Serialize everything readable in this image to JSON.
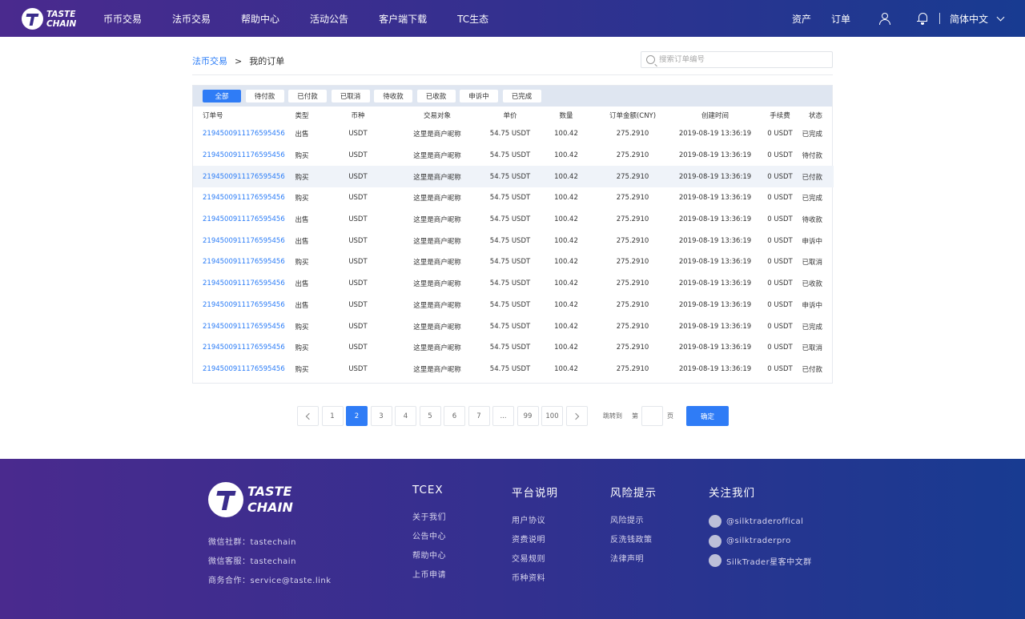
{
  "header": {
    "logo": {
      "line1": "TASTE",
      "line2": "CHAIN"
    },
    "nav": [
      "币币交易",
      "法币交易",
      "帮助中心",
      "活动公告",
      "客户端下载",
      "TC生态"
    ],
    "assets": "资产",
    "orders": "订单",
    "language": "简体中文"
  },
  "breadcrumb": {
    "parent": "法币交易",
    "separator": ">",
    "current": "我的订单"
  },
  "search": {
    "placeholder": "搜索订单编号"
  },
  "filters": [
    "全部",
    "待付款",
    "已付款",
    "已取消",
    "待收款",
    "已收款",
    "申诉中",
    "已完成"
  ],
  "table": {
    "headers": [
      "订单号",
      "类型",
      "币种",
      "交易对象",
      "单价",
      "数量",
      "订单金额(CNY)",
      "创建时间",
      "手续费",
      "状态"
    ],
    "rows": [
      {
        "id": "2194500911176595456",
        "type": "出售",
        "kind": "sell",
        "coin": "USDT",
        "party": "这里是商户昵称",
        "price": "54.75 USDT",
        "qty": "100.42",
        "amount": "275.2910",
        "time": "2019-08-19 13:36:19",
        "fee": "0 USDT",
        "status": "已完成",
        "status_style": "gray"
      },
      {
        "id": "2194500911176595456",
        "type": "购买",
        "kind": "buy",
        "coin": "USDT",
        "party": "这里是商户昵称",
        "price": "54.75 USDT",
        "qty": "100.42",
        "amount": "275.2910",
        "time": "2019-08-19 13:36:19",
        "fee": "0 USDT",
        "status": "待付款",
        "status_style": "blue"
      },
      {
        "id": "2194500911176595456",
        "type": "购买",
        "kind": "buy",
        "coin": "USDT",
        "party": "这里是商户昵称",
        "price": "54.75 USDT",
        "qty": "100.42",
        "amount": "275.2910",
        "time": "2019-08-19 13:36:19",
        "fee": "0 USDT",
        "status": "已付款",
        "status_style": "blue"
      },
      {
        "id": "2194500911176595456",
        "type": "购买",
        "kind": "buy",
        "coin": "USDT",
        "party": "这里是商户昵称",
        "price": "54.75 USDT",
        "qty": "100.42",
        "amount": "275.2910",
        "time": "2019-08-19 13:36:19",
        "fee": "0 USDT",
        "status": "已完成",
        "status_style": "gray"
      },
      {
        "id": "2194500911176595456",
        "type": "出售",
        "kind": "sell",
        "coin": "USDT",
        "party": "这里是商户昵称",
        "price": "54.75 USDT",
        "qty": "100.42",
        "amount": "275.2910",
        "time": "2019-08-19 13:36:19",
        "fee": "0 USDT",
        "status": "待收款",
        "status_style": "blue"
      },
      {
        "id": "2194500911176595456",
        "type": "出售",
        "kind": "sell",
        "coin": "USDT",
        "party": "这里是商户昵称",
        "price": "54.75 USDT",
        "qty": "100.42",
        "amount": "275.2910",
        "time": "2019-08-19 13:36:19",
        "fee": "0 USDT",
        "status": "申诉中",
        "status_style": "blue"
      },
      {
        "id": "2194500911176595456",
        "type": "购买",
        "kind": "buy",
        "coin": "USDT",
        "party": "这里是商户昵称",
        "price": "54.75 USDT",
        "qty": "100.42",
        "amount": "275.2910",
        "time": "2019-08-19 13:36:19",
        "fee": "0 USDT",
        "status": "已取消",
        "status_style": "gray"
      },
      {
        "id": "2194500911176595456",
        "type": "出售",
        "kind": "sell",
        "coin": "USDT",
        "party": "这里是商户昵称",
        "price": "54.75 USDT",
        "qty": "100.42",
        "amount": "275.2910",
        "time": "2019-08-19 13:36:19",
        "fee": "0 USDT",
        "status": "已收款",
        "status_style": "blue"
      },
      {
        "id": "2194500911176595456",
        "type": "出售",
        "kind": "sell",
        "coin": "USDT",
        "party": "这里是商户昵称",
        "price": "54.75 USDT",
        "qty": "100.42",
        "amount": "275.2910",
        "time": "2019-08-19 13:36:19",
        "fee": "0 USDT",
        "status": "申诉中",
        "status_style": "blue"
      },
      {
        "id": "2194500911176595456",
        "type": "购买",
        "kind": "buy",
        "coin": "USDT",
        "party": "这里是商户昵称",
        "price": "54.75 USDT",
        "qty": "100.42",
        "amount": "275.2910",
        "time": "2019-08-19 13:36:19",
        "fee": "0 USDT",
        "status": "已完成",
        "status_style": "gray"
      },
      {
        "id": "2194500911176595456",
        "type": "购买",
        "kind": "buy",
        "coin": "USDT",
        "party": "这里是商户昵称",
        "price": "54.75 USDT",
        "qty": "100.42",
        "amount": "275.2910",
        "time": "2019-08-19 13:36:19",
        "fee": "0 USDT",
        "status": "已取消",
        "status_style": "gray"
      },
      {
        "id": "2194500911176595456",
        "type": "购买",
        "kind": "buy",
        "coin": "USDT",
        "party": "这里是商户昵称",
        "price": "54.75 USDT",
        "qty": "100.42",
        "amount": "275.2910",
        "time": "2019-08-19 13:36:19",
        "fee": "0 USDT",
        "status": "已付款",
        "status_style": "blue"
      }
    ]
  },
  "pagination": {
    "pages": [
      "1",
      "2",
      "3",
      "4",
      "5",
      "6",
      "7",
      "...",
      "99",
      "100"
    ],
    "current": "2",
    "jump_label": "跳转到",
    "jump_di": "第",
    "jump_ye": "页",
    "confirm": "确定"
  },
  "footer": {
    "logo": {
      "line1": "TASTE",
      "line2": "CHAIN"
    },
    "info": [
      "微信社群：tastechain",
      "微信客服：tastechain",
      "商务合作：service@taste.link"
    ],
    "columns": [
      {
        "title": "TCEX",
        "links": [
          "关于我们",
          "公告中心",
          "帮助中心",
          "上币申请"
        ]
      },
      {
        "title": "平台说明",
        "links": [
          "用户协议",
          "资费说明",
          "交易规则",
          "币种资料"
        ]
      },
      {
        "title": "风险提示",
        "links": [
          "风险提示",
          "反洗钱政策",
          "法律声明"
        ]
      }
    ],
    "follow": {
      "title": "关注我们",
      "items": [
        "@silktraderoffical",
        "@silktraderpro",
        "SilkTrader星客中文群"
      ]
    }
  },
  "colors": {
    "accent": "#2f7cf6",
    "sell": "#f5a623",
    "buy": "#22b573",
    "header_start": "#4a2a8e",
    "header_end": "#183b91"
  }
}
